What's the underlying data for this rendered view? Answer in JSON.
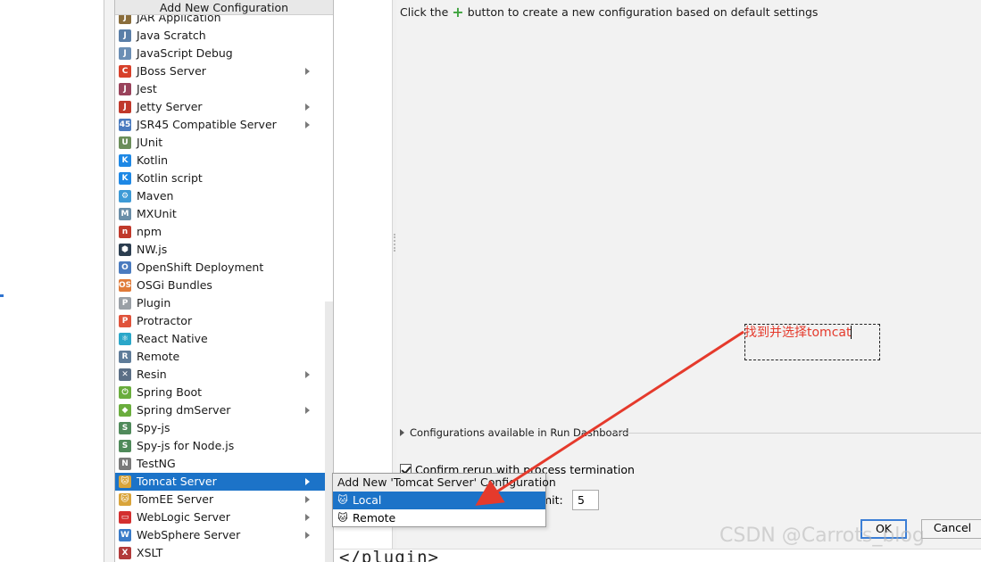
{
  "dialog": {
    "hint_prefix": "Click the",
    "hint_suffix": "button to create a new configuration based on default settings",
    "run_dashboard_label": "Configurations available in Run Dashboard",
    "confirm_rerun_label": "Confirm rerun with process termination",
    "limit_label": "mit:",
    "limit_value": "5",
    "ok_label": "OK",
    "cancel_label": "Cancel",
    "code_fragment": "</plugin>"
  },
  "popup": {
    "title": "Add New Configuration",
    "items": [
      {
        "label": "JAR Application",
        "icon": "jar-icon",
        "color": "#8a6d3b",
        "submenu": false
      },
      {
        "label": "Java Scratch",
        "icon": "java-scratch-icon",
        "color": "#5a7fa8",
        "submenu": false
      },
      {
        "label": "JavaScript Debug",
        "icon": "js-debug-icon",
        "color": "#6b8fb5",
        "submenu": false
      },
      {
        "label": "JBoss Server",
        "icon": "jboss-icon",
        "color": "#d7402a",
        "submenu": true
      },
      {
        "label": "Jest",
        "icon": "jest-icon",
        "color": "#99425b",
        "submenu": false
      },
      {
        "label": "Jetty Server",
        "icon": "jetty-icon",
        "color": "#c0392b",
        "submenu": true
      },
      {
        "label": "JSR45 Compatible Server",
        "icon": "jsr45-icon",
        "color": "#4a7bbf",
        "submenu": true
      },
      {
        "label": "JUnit",
        "icon": "junit-icon",
        "color": "#6b8e5a",
        "submenu": false
      },
      {
        "label": "Kotlin",
        "icon": "kotlin-icon",
        "color": "#1e88e5",
        "submenu": false
      },
      {
        "label": "Kotlin script",
        "icon": "kotlin-script-icon",
        "color": "#1e88e5",
        "submenu": false
      },
      {
        "label": "Maven",
        "icon": "maven-gear-icon",
        "color": "#3d9ad6",
        "submenu": false
      },
      {
        "label": "MXUnit",
        "icon": "mxunit-icon",
        "color": "#6a8ea8",
        "submenu": false
      },
      {
        "label": "npm",
        "icon": "npm-icon",
        "color": "#c0392b",
        "submenu": false
      },
      {
        "label": "NW.js",
        "icon": "nwjs-icon",
        "color": "#2c3e50",
        "submenu": false
      },
      {
        "label": "OpenShift Deployment",
        "icon": "openshift-icon",
        "color": "#4a7bbf",
        "submenu": false
      },
      {
        "label": "OSGi Bundles",
        "icon": "osgi-icon",
        "color": "#e07b39",
        "submenu": false
      },
      {
        "label": "Plugin",
        "icon": "plugin-icon",
        "color": "#9aa0a6",
        "submenu": false
      },
      {
        "label": "Protractor",
        "icon": "protractor-icon",
        "color": "#e0533b",
        "submenu": false
      },
      {
        "label": "React Native",
        "icon": "react-icon",
        "color": "#2aa7c9",
        "submenu": false
      },
      {
        "label": "Remote",
        "icon": "remote-icon",
        "color": "#5f7c99",
        "submenu": false
      },
      {
        "label": "Resin",
        "icon": "resin-icon",
        "color": "#5b6f86",
        "submenu": true
      },
      {
        "label": "Spring Boot",
        "icon": "spring-boot-icon",
        "color": "#6aad3d",
        "submenu": false
      },
      {
        "label": "Spring dmServer",
        "icon": "spring-dm-icon",
        "color": "#6aad3d",
        "submenu": true
      },
      {
        "label": "Spy-js",
        "icon": "spyjs-icon",
        "color": "#4f8a5a",
        "submenu": false
      },
      {
        "label": "Spy-js for Node.js",
        "icon": "spyjs-node-icon",
        "color": "#4f8a5a",
        "submenu": false
      },
      {
        "label": "TestNG",
        "icon": "testng-icon",
        "color": "#7a7a7a",
        "submenu": false
      },
      {
        "label": "Tomcat Server",
        "icon": "tomcat-icon",
        "color": "#d9a43a",
        "submenu": true,
        "selected": true
      },
      {
        "label": "TomEE Server",
        "icon": "tomee-icon",
        "color": "#d9a43a",
        "submenu": true
      },
      {
        "label": "WebLogic Server",
        "icon": "weblogic-icon",
        "color": "#d32f2f",
        "submenu": true
      },
      {
        "label": "WebSphere Server",
        "icon": "websphere-icon",
        "color": "#3a7bc8",
        "submenu": true
      },
      {
        "label": "XSLT",
        "icon": "xslt-icon",
        "color": "#b23b3b",
        "submenu": false
      }
    ]
  },
  "submenu": {
    "title": "Add New 'Tomcat Server' Configuration",
    "items": [
      {
        "label": "Local",
        "icon": "tomcat-local-icon",
        "selected": true
      },
      {
        "label": "Remote",
        "icon": "tomcat-remote-icon",
        "selected": false
      }
    ]
  },
  "annotation": {
    "text": "找到并选择tomcat",
    "color": "#e53a2c"
  },
  "watermark": "CSDN @Carrots_blog"
}
